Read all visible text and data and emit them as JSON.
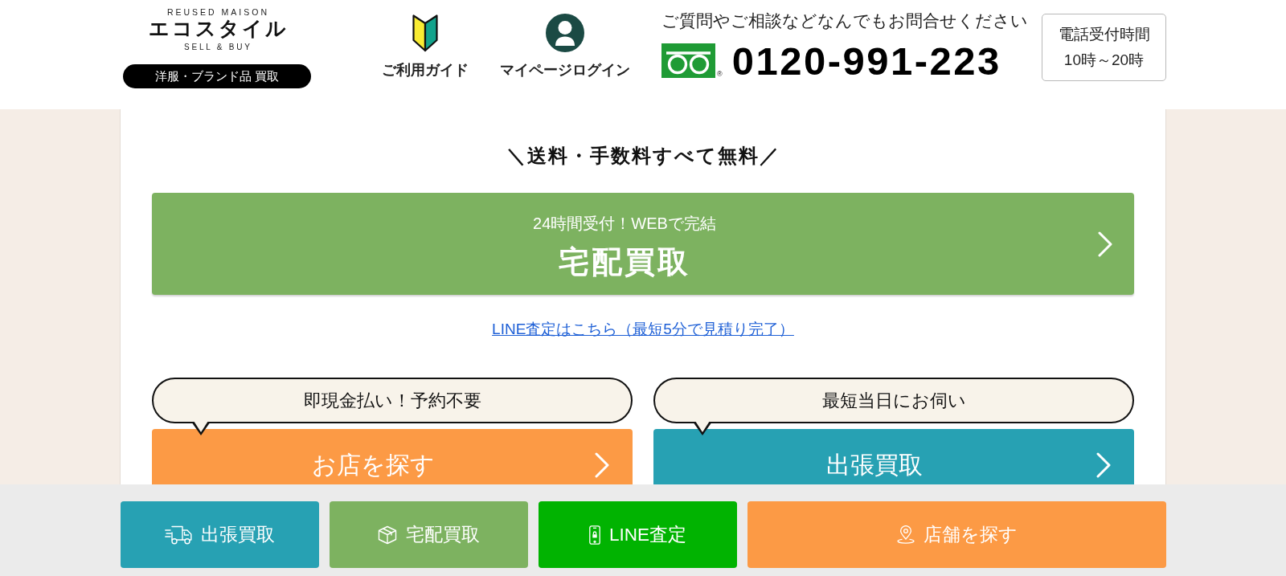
{
  "header": {
    "logo": {
      "top_line": "REUSED MAISON",
      "name": "エコスタイル",
      "bottom_line": "SELL & BUY",
      "tag": "洋服・ブランド品 買取"
    },
    "nav": [
      {
        "kind": "guide",
        "label": "ご利用ガイド"
      },
      {
        "kind": "mypage",
        "label": "マイページログイン"
      }
    ],
    "contact": {
      "note": "ご質問やご相談などなんでもお問合せください",
      "registered_mark": "®",
      "phone": "0120-991-223"
    },
    "hours": {
      "title": "電話受付時間",
      "time": "10時～20時"
    }
  },
  "main": {
    "headline": "＼送料・手数料すべて無料／",
    "delivery_button": {
      "subtitle": "24時間受付！WEBで完結",
      "title": "宅配買取"
    },
    "line_link": "LINE査定はこちら（最短5分で見積り完了）",
    "options": [
      {
        "kind": "store",
        "bubble": "即現金払い！予約不要",
        "label": "お店を探す"
      },
      {
        "kind": "visit",
        "bubble": "最短当日にお伺い",
        "label": "出張買取"
      }
    ]
  },
  "bottom_bar": [
    {
      "kind": "visit",
      "label": "出張買取"
    },
    {
      "kind": "delivery",
      "label": "宅配買取"
    },
    {
      "kind": "line",
      "label": "LINE査定"
    },
    {
      "kind": "store",
      "label": "店舗を探す"
    }
  ]
}
